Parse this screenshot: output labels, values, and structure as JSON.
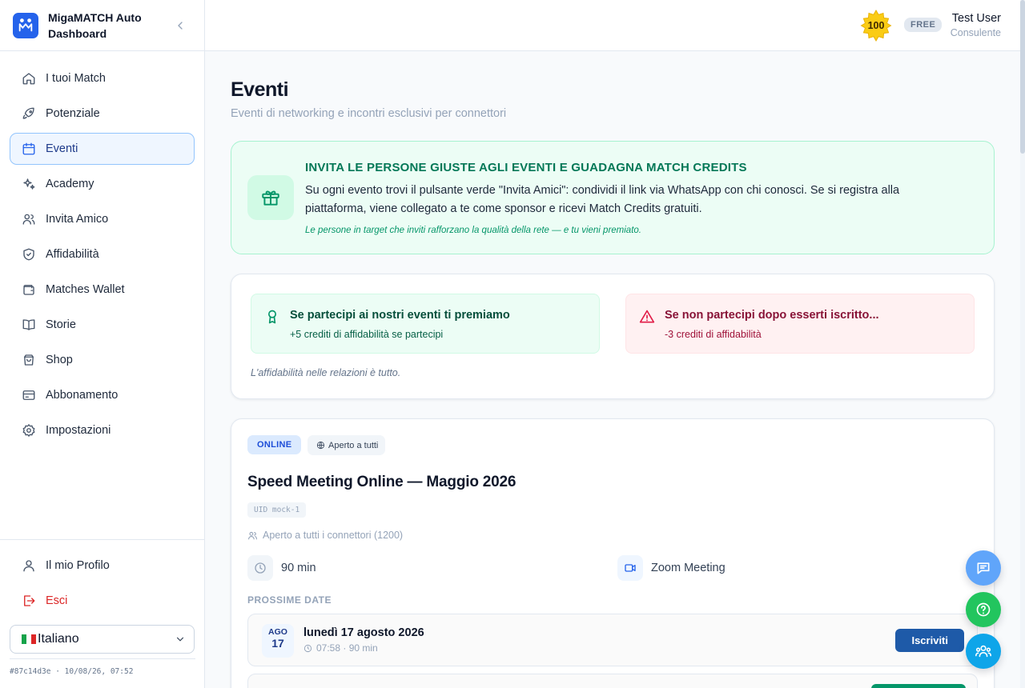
{
  "app": {
    "name": "MigaMATCH Auto Dashboard"
  },
  "sidebar": {
    "items": [
      {
        "label": "I tuoi Match",
        "icon": "home-icon"
      },
      {
        "label": "Potenziale",
        "icon": "rocket-icon"
      },
      {
        "label": "Eventi",
        "icon": "calendar-icon",
        "active": true
      },
      {
        "label": "Academy",
        "icon": "sparkles-icon"
      },
      {
        "label": "Invita Amico",
        "icon": "users-icon"
      },
      {
        "label": "Affidabilità",
        "icon": "shield-check-icon"
      },
      {
        "label": "Matches Wallet",
        "icon": "wallet-icon"
      },
      {
        "label": "Storie",
        "icon": "book-icon"
      },
      {
        "label": "Shop",
        "icon": "shopping-bag-icon"
      },
      {
        "label": "Abbonamento",
        "icon": "credit-card-icon"
      },
      {
        "label": "Impostazioni",
        "icon": "gear-icon"
      }
    ],
    "profile_label": "Il mio Profilo",
    "logout_label": "Esci",
    "language": "Italiano",
    "build": "#87c14d3e · 10/08/26, 07:52"
  },
  "header": {
    "credits": "100",
    "plan": "FREE",
    "user_name": "Test User",
    "user_role": "Consulente"
  },
  "page": {
    "title": "Eventi",
    "subtitle": "Eventi di networking e incontri esclusivi per connettori"
  },
  "invite_banner": {
    "title": "INVITA LE PERSONE GIUSTE AGLI EVENTI E GUADAGNA MATCH CREDITS",
    "body": "Su ogni evento trovi il pulsante verde \"Invita Amici\": condividi il link via WhatsApp con chi conosci. Se si registra alla piattaforma, viene collegato a te come sponsor e ricevi Match Credits gratuiti.",
    "note": "Le persone in target che inviti rafforzano la qualità della rete — e tu vieni premiato."
  },
  "reliability": {
    "reward_title": "Se partecipi ai nostri eventi ti premiamo",
    "reward_sub": "+5 crediti di affidabilità se partecipi",
    "penalty_title": "Se non partecipi dopo esserti iscritto...",
    "penalty_sub": "-3 crediti di affidabilità",
    "note": "L'affidabilità nelle relazioni è tutto."
  },
  "event": {
    "type_tag": "ONLINE",
    "access_tag": "Aperto a tutti",
    "title": "Speed Meeting Online — Maggio 2026",
    "uid": "UID mock-1",
    "audience": "Aperto a tutti i connettori (1200)",
    "duration": "90 min",
    "location": "Zoom Meeting",
    "dates_label": "PROSSIME DATE",
    "next_date": {
      "month": "AGO",
      "day": "17",
      "label": "lunedì 17 agosto 2026",
      "time": "07:58 · 90 min",
      "button": "Iscriviti"
    }
  },
  "colors": {
    "primary": "#2563eb",
    "success": "#059669",
    "danger": "#e11d48",
    "button": "#1e5aa8"
  }
}
